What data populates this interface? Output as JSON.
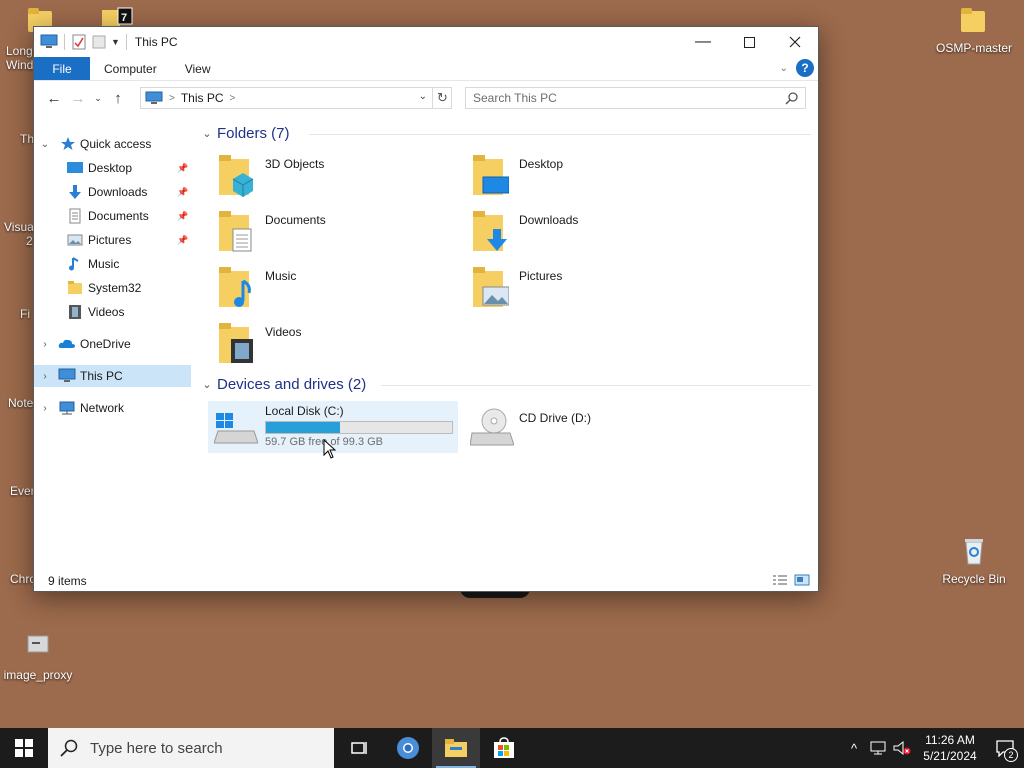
{
  "desktop": {
    "icons": [
      {
        "label": "OSMP-master"
      },
      {
        "label": "Recycle Bin"
      },
      {
        "label": "image_proxy"
      }
    ],
    "left_clipped_labels": [
      "Long",
      "Wind",
      "Th",
      "Visua",
      "2",
      "Fi",
      "Note",
      "Ever",
      "Chro"
    ]
  },
  "window": {
    "title": "This PC",
    "tabs": {
      "file": "File",
      "computer": "Computer",
      "view": "View"
    },
    "address": {
      "crumb": "This PC",
      "sep": ">"
    },
    "search_placeholder": "Search This PC",
    "nav": {
      "quick_access": "Quick access",
      "items": [
        {
          "label": "Desktop"
        },
        {
          "label": "Downloads"
        },
        {
          "label": "Documents"
        },
        {
          "label": "Pictures"
        },
        {
          "label": "Music"
        },
        {
          "label": "System32"
        },
        {
          "label": "Videos"
        }
      ],
      "onedrive": "OneDrive",
      "this_pc": "This PC",
      "network": "Network"
    },
    "folders_header": "Folders (7)",
    "folders": [
      {
        "label": "3D Objects"
      },
      {
        "label": "Desktop"
      },
      {
        "label": "Documents"
      },
      {
        "label": "Downloads"
      },
      {
        "label": "Music"
      },
      {
        "label": "Pictures"
      },
      {
        "label": "Videos"
      }
    ],
    "drives_header": "Devices and drives (2)",
    "drives": [
      {
        "label": "Local Disk (C:)",
        "free_text": "59.7 GB free of 99.3 GB",
        "used_fraction": 0.399
      },
      {
        "label": "CD Drive (D:)"
      }
    ],
    "status": "9 items"
  },
  "taskbar": {
    "search_placeholder": "Type here to search",
    "time": "11:26 AM",
    "date": "5/21/2024",
    "notification_count": "2"
  },
  "colors": {
    "accent": "#1a6fc4",
    "selection": "#cce4f7",
    "bar_fill": "#26a0da",
    "desktop": "#9c6a4c"
  }
}
